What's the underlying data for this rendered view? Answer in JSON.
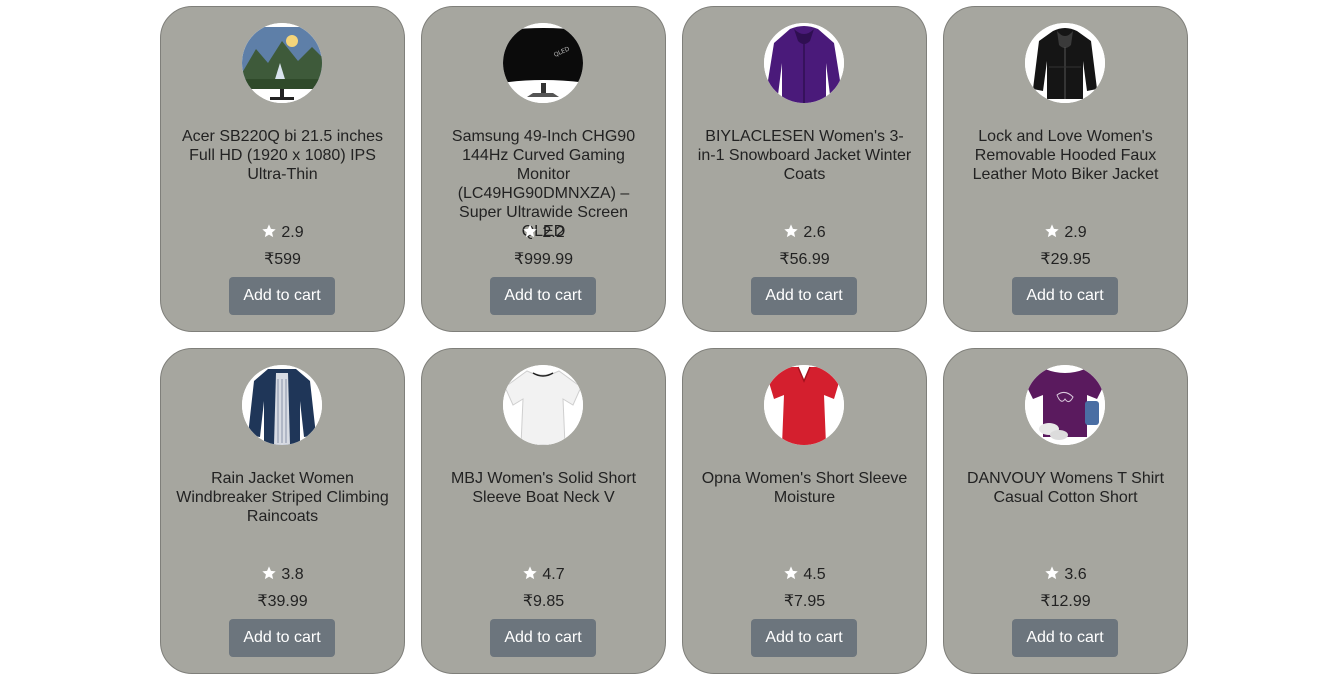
{
  "colors": {
    "card_background": "#a6a69f",
    "card_border": "#7f7f7a",
    "button_background": "#6c757d",
    "button_text": "#ffffff",
    "star": "#ffffff"
  },
  "products": [
    {
      "image_icon": "monitor-landscape-icon",
      "title": "Acer SB220Q bi 21.5 inches Full HD (1920 x 1080) IPS Ultra-Thin",
      "rating": "2.9",
      "price": "₹599",
      "button_label": "Add to cart"
    },
    {
      "image_icon": "curved-monitor-icon",
      "title": "Samsung 49-Inch CHG90 144Hz Curved Gaming Monitor (LC49HG90DMNXZA) – Super Ultrawide Screen QLED",
      "rating": "2.2",
      "price": "₹999.99",
      "button_label": "Add to cart"
    },
    {
      "image_icon": "purple-jacket-icon",
      "title": "BIYLACLESEN Women's 3-in-1 Snowboard Jacket Winter Coats",
      "rating": "2.6",
      "price": "₹56.99",
      "button_label": "Add to cart"
    },
    {
      "image_icon": "black-leather-jacket-icon",
      "title": "Lock and Love Women's Removable Hooded Faux Leather Moto Biker Jacket",
      "rating": "2.9",
      "price": "₹29.95",
      "button_label": "Add to cart"
    },
    {
      "image_icon": "navy-rain-jacket-icon",
      "title": "Rain Jacket Women Windbreaker Striped Climbing Raincoats",
      "rating": "3.8",
      "price": "₹39.99",
      "button_label": "Add to cart"
    },
    {
      "image_icon": "white-tshirt-icon",
      "title": "MBJ Women's Solid Short Sleeve Boat Neck V",
      "rating": "4.7",
      "price": "₹9.85",
      "button_label": "Add to cart"
    },
    {
      "image_icon": "red-tshirt-icon",
      "title": "Opna Women's Short Sleeve Moisture",
      "rating": "4.5",
      "price": "₹7.95",
      "button_label": "Add to cart"
    },
    {
      "image_icon": "purple-tshirt-icon",
      "title": "DANVOUY Womens T Shirt Casual Cotton Short",
      "rating": "3.6",
      "price": "₹12.99",
      "button_label": "Add to cart"
    }
  ]
}
